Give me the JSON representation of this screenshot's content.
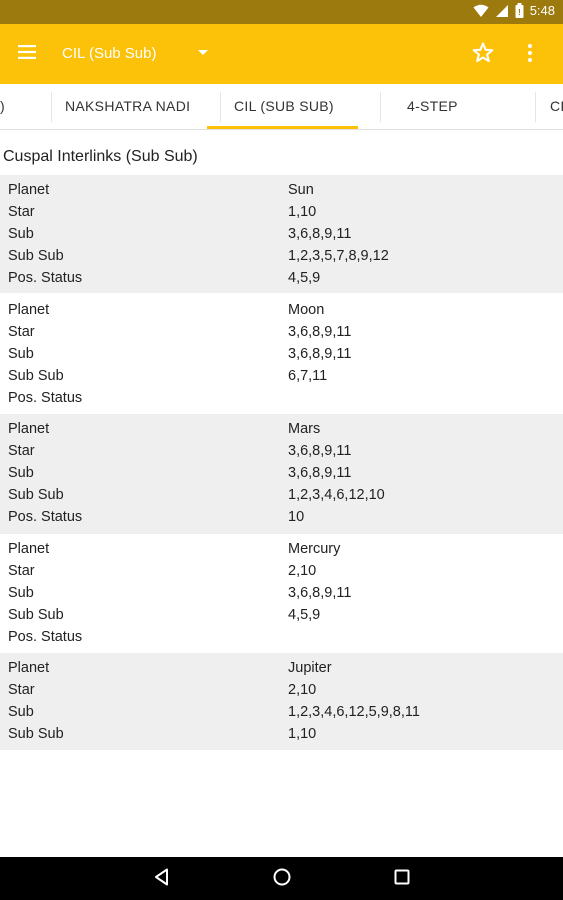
{
  "status_bar": {
    "time": "5:48"
  },
  "app_bar": {
    "spinner_label": "CIL (Sub Sub)"
  },
  "tabs": [
    {
      "label": ")"
    },
    {
      "label": "NAKSHATRA NADI"
    },
    {
      "label": "CIL (SUB SUB)"
    },
    {
      "label": "4-STEP"
    },
    {
      "label": "CI"
    }
  ],
  "selected_tab": "CIL (SUB SUB)",
  "section_title": "Cuspal Interlinks (Sub Sub)",
  "row_labels": {
    "planet": "Planet",
    "star": "Star",
    "sub": "Sub",
    "subsub": "Sub Sub",
    "pos_status": "Pos. Status"
  },
  "planets": [
    {
      "planet": "Sun",
      "star": "1,10",
      "sub": "3,6,8,9,11",
      "subsub": "1,2,3,5,7,8,9,12",
      "pos_status": "4,5,9"
    },
    {
      "planet": "Moon",
      "star": "3,6,8,9,11",
      "sub": "3,6,8,9,11",
      "subsub": "6,7,11",
      "pos_status": ""
    },
    {
      "planet": "Mars",
      "star": "3,6,8,9,11",
      "sub": "3,6,8,9,11",
      "subsub": "1,2,3,4,6,12,10",
      "pos_status": "10"
    },
    {
      "planet": "Mercury",
      "star": "2,10",
      "sub": "3,6,8,9,11",
      "subsub": "4,5,9",
      "pos_status": ""
    },
    {
      "planet": "Jupiter",
      "star": "2,10",
      "sub": "1,2,3,4,6,12,5,9,8,11",
      "subsub": "1,10"
    }
  ],
  "colors": {
    "accent": "#fcc20a",
    "status_bar": "#9c7a0e",
    "row_shade": "#efefef"
  }
}
